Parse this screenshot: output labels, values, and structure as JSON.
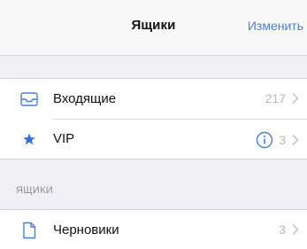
{
  "navbar": {
    "title": "Ящики",
    "edit_label": "Изменить"
  },
  "mailboxes": [
    {
      "label": "Входящие",
      "count": "217",
      "icon": "inbox-tray-icon"
    },
    {
      "label": "VIP",
      "count": "3",
      "icon": "star-icon",
      "info_icon": "info-circle-icon"
    }
  ],
  "section": {
    "header": "ЯЩИКИ"
  },
  "folders": [
    {
      "label": "Черновики",
      "count": "3",
      "icon": "document-icon"
    }
  ],
  "colors": {
    "accent": "#4a7fd8",
    "background": "#efeff4",
    "secondary_text": "#b8b8bc"
  }
}
